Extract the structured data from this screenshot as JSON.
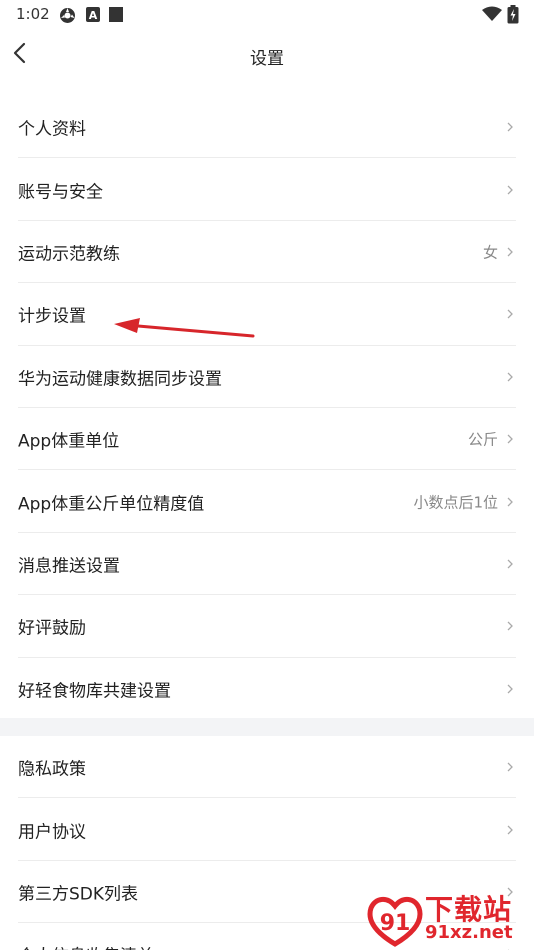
{
  "status_bar": {
    "time": "1:02",
    "icons": [
      "settings-icon",
      "a-badge-icon",
      "square-icon",
      "wifi-icon",
      "battery-icon"
    ]
  },
  "header": {
    "title": "设置",
    "back_icon": "chevron-left-icon"
  },
  "section1": {
    "items": [
      {
        "label": "个人资料",
        "value": ""
      },
      {
        "label": "账号与安全",
        "value": ""
      },
      {
        "label": "运动示范教练",
        "value": "女"
      },
      {
        "label": "计步设置",
        "value": ""
      },
      {
        "label": "华为运动健康数据同步设置",
        "value": ""
      },
      {
        "label": "App体重单位",
        "value": "公斤"
      },
      {
        "label": "App体重公斤单位精度值",
        "value": "小数点后1位"
      },
      {
        "label": "消息推送设置",
        "value": ""
      },
      {
        "label": "好评鼓励",
        "value": ""
      },
      {
        "label": "好轻食物库共建设置",
        "value": ""
      }
    ]
  },
  "section2": {
    "items": [
      {
        "label": "隐私政策",
        "value": ""
      },
      {
        "label": "用户协议",
        "value": ""
      },
      {
        "label": "第三方SDK列表",
        "value": ""
      },
      {
        "label": "个人信息收集清单",
        "value": ""
      }
    ]
  },
  "watermark": {
    "brand": "下载站",
    "domain": "91xz.net",
    "logo_icon": "watermark-logo-icon"
  },
  "colors": {
    "annotation_arrow": "#d7262b",
    "divider": "#ececec",
    "section_gap": "#f3f4f6",
    "watermark": "#e0262d"
  }
}
